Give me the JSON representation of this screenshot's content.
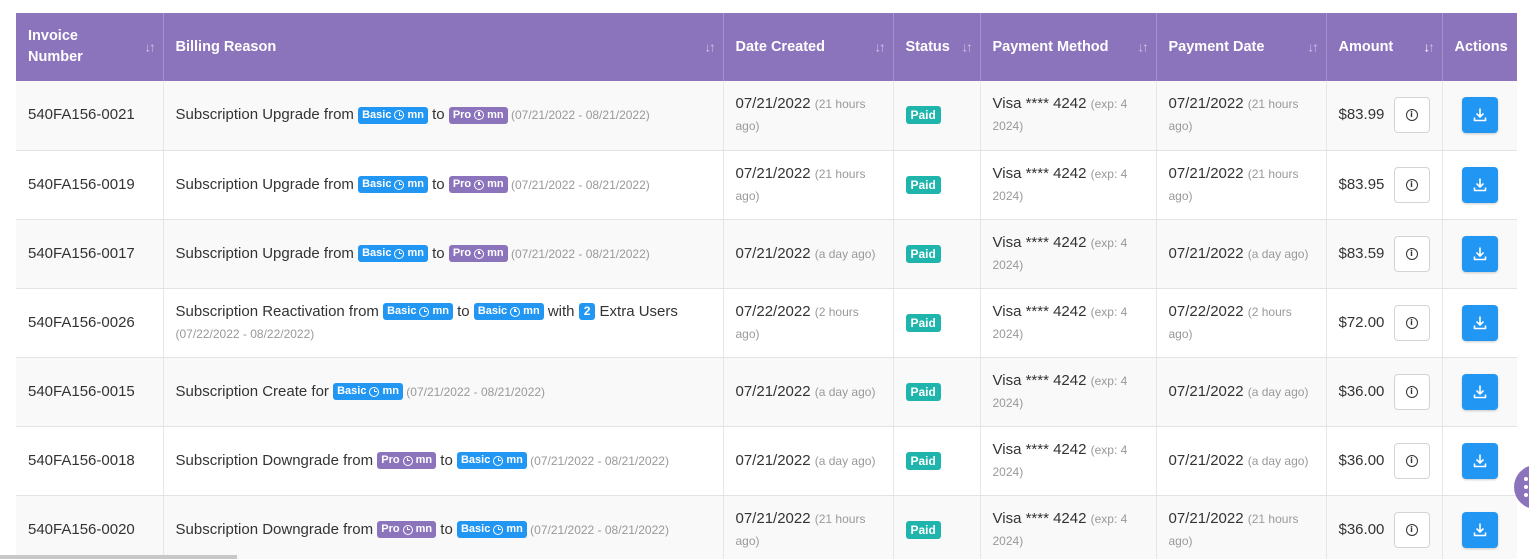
{
  "columns": [
    {
      "key": "invoice",
      "label": "Invoice Number",
      "sort_icon": "sort-icon",
      "active": false
    },
    {
      "key": "reason",
      "label": "Billing Reason",
      "sort_icon": "sort-icon",
      "active": false
    },
    {
      "key": "created",
      "label": "Date Created",
      "sort_icon": "sort-icon",
      "active": false
    },
    {
      "key": "status",
      "label": "Status",
      "sort_icon": "sort-icon",
      "active": false
    },
    {
      "key": "method",
      "label": "Payment Method",
      "sort_icon": "sort-icon",
      "active": false
    },
    {
      "key": "paydate",
      "label": "Payment Date",
      "sort_icon": "sort-icon",
      "active": false
    },
    {
      "key": "amount",
      "label": "Amount",
      "sort_icon": "sort-desc-icon",
      "active": true
    },
    {
      "key": "actions",
      "label": "Actions",
      "sort_icon": null,
      "active": false
    }
  ],
  "rows": [
    {
      "invoice": "540FA156-0021",
      "reason": [
        {
          "t": "text",
          "v": "Subscription Upgrade from "
        },
        {
          "t": "plan",
          "plan": "basic",
          "v": "Basic",
          "suffix": "mn"
        },
        {
          "t": "text",
          "v": " to "
        },
        {
          "t": "plan",
          "plan": "pro",
          "v": "Pro",
          "suffix": "mn"
        },
        {
          "t": "muted",
          "v": " (07/21/2022 - 08/21/2022)"
        }
      ],
      "created": "07/21/2022",
      "created_rel": "(21 hours ago)",
      "status": "Paid",
      "method": "Visa **** 4242",
      "method_exp": "(exp: 4 2024)",
      "paydate": "07/21/2022",
      "paydate_rel": "(21 hours ago)",
      "amount": "$83.99"
    },
    {
      "invoice": "540FA156-0019",
      "reason": [
        {
          "t": "text",
          "v": "Subscription Upgrade from "
        },
        {
          "t": "plan",
          "plan": "basic",
          "v": "Basic",
          "suffix": "mn"
        },
        {
          "t": "text",
          "v": " to "
        },
        {
          "t": "plan",
          "plan": "pro",
          "v": "Pro",
          "suffix": "mn"
        },
        {
          "t": "muted",
          "v": " (07/21/2022 - 08/21/2022)"
        }
      ],
      "created": "07/21/2022",
      "created_rel": "(21 hours ago)",
      "status": "Paid",
      "method": "Visa **** 4242",
      "method_exp": "(exp: 4 2024)",
      "paydate": "07/21/2022",
      "paydate_rel": "(21 hours ago)",
      "amount": "$83.95"
    },
    {
      "invoice": "540FA156-0017",
      "reason": [
        {
          "t": "text",
          "v": "Subscription Upgrade from "
        },
        {
          "t": "plan",
          "plan": "basic",
          "v": "Basic",
          "suffix": "mn"
        },
        {
          "t": "text",
          "v": " to "
        },
        {
          "t": "plan",
          "plan": "pro",
          "v": "Pro",
          "suffix": "mn"
        },
        {
          "t": "muted",
          "v": " (07/21/2022 - 08/21/2022)"
        }
      ],
      "created": "07/21/2022",
      "created_rel": "(a day ago)",
      "status": "Paid",
      "method": "Visa **** 4242",
      "method_exp": "(exp: 4 2024)",
      "paydate": "07/21/2022",
      "paydate_rel": "(a day ago)",
      "amount": "$83.59"
    },
    {
      "invoice": "540FA156-0026",
      "reason": [
        {
          "t": "text",
          "v": "Subscription Reactivation from "
        },
        {
          "t": "plan",
          "plan": "basic",
          "v": "Basic",
          "suffix": "mn"
        },
        {
          "t": "text",
          "v": " to "
        },
        {
          "t": "plan",
          "plan": "basic",
          "v": "Basic",
          "suffix": "mn"
        },
        {
          "t": "text",
          "v": " with "
        },
        {
          "t": "count",
          "v": "2"
        },
        {
          "t": "text",
          "v": " Extra Users"
        },
        {
          "t": "br"
        },
        {
          "t": "muted",
          "v": "(07/22/2022 - 08/22/2022)"
        }
      ],
      "created": "07/22/2022",
      "created_rel": "(2 hours ago)",
      "status": "Paid",
      "method": "Visa **** 4242",
      "method_exp": "(exp: 4 2024)",
      "paydate": "07/22/2022",
      "paydate_rel": "(2 hours ago)",
      "amount": "$72.00"
    },
    {
      "invoice": "540FA156-0015",
      "reason": [
        {
          "t": "text",
          "v": "Subscription Create for "
        },
        {
          "t": "plan",
          "plan": "basic",
          "v": "Basic",
          "suffix": "mn"
        },
        {
          "t": "muted",
          "v": " (07/21/2022 - 08/21/2022)"
        }
      ],
      "created": "07/21/2022",
      "created_rel": "(a day ago)",
      "status": "Paid",
      "method": "Visa **** 4242",
      "method_exp": "(exp: 4 2024)",
      "paydate": "07/21/2022",
      "paydate_rel": "(a day ago)",
      "amount": "$36.00"
    },
    {
      "invoice": "540FA156-0018",
      "reason": [
        {
          "t": "text",
          "v": "Subscription Downgrade from "
        },
        {
          "t": "plan",
          "plan": "pro",
          "v": "Pro",
          "suffix": "mn"
        },
        {
          "t": "text",
          "v": " to "
        },
        {
          "t": "plan",
          "plan": "basic",
          "v": "Basic",
          "suffix": "mn"
        },
        {
          "t": "muted",
          "v": " (07/21/2022 - 08/21/2022)"
        }
      ],
      "created": "07/21/2022",
      "created_rel": "(a day ago)",
      "status": "Paid",
      "method": "Visa **** 4242",
      "method_exp": "(exp: 4 2024)",
      "paydate": "07/21/2022",
      "paydate_rel": "(a day ago)",
      "amount": "$36.00"
    },
    {
      "invoice": "540FA156-0020",
      "reason": [
        {
          "t": "text",
          "v": "Subscription Downgrade from "
        },
        {
          "t": "plan",
          "plan": "pro",
          "v": "Pro",
          "suffix": "mn"
        },
        {
          "t": "text",
          "v": " to "
        },
        {
          "t": "plan",
          "plan": "basic",
          "v": "Basic",
          "suffix": "mn"
        },
        {
          "t": "muted",
          "v": " (07/21/2022 - 08/21/2022)"
        }
      ],
      "created": "07/21/2022",
      "created_rel": "(21 hours ago)",
      "status": "Paid",
      "method": "Visa **** 4242",
      "method_exp": "(exp: 4 2024)",
      "paydate": "07/21/2022",
      "paydate_rel": "(21 hours ago)",
      "amount": "$36.00"
    }
  ],
  "row_actions": {
    "info_icon": "info-icon",
    "download_icon": "download-icon"
  },
  "fab": {
    "icon": "more-vertical-icon"
  },
  "colors": {
    "header_bg": "#8c74bd",
    "basic_badge": "#2196f3",
    "pro_badge": "#8c74bd",
    "paid_badge": "#1fb5ad",
    "download_button": "#2196f3"
  }
}
